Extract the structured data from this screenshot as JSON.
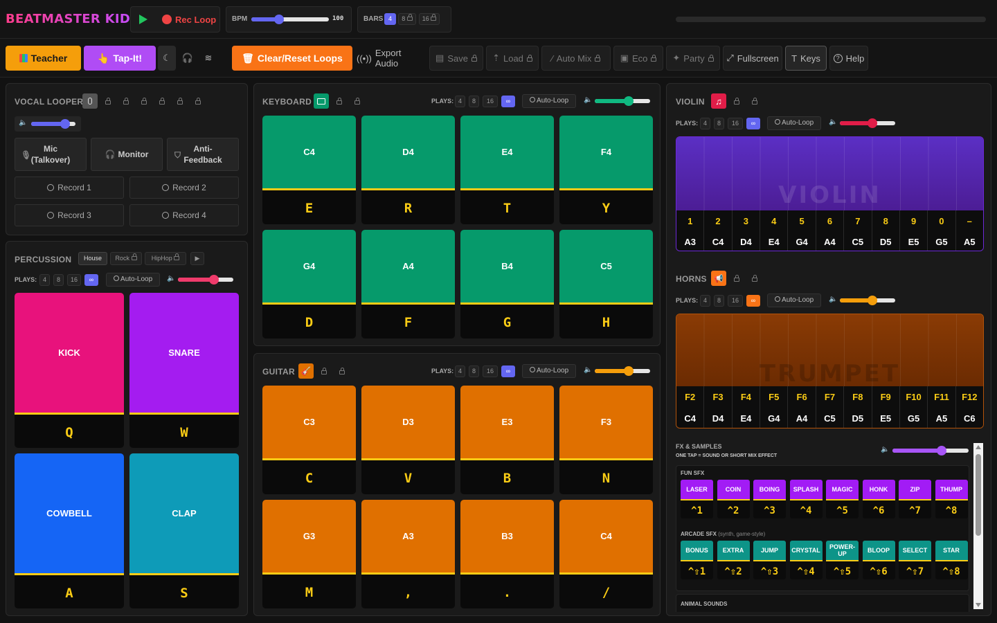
{
  "app": {
    "title": "BEATMASTER KIDS"
  },
  "transport": {
    "rec_loop": "Rec Loop",
    "bpm_label": "BPM",
    "bpm_value": "100",
    "bars_label": "BARS",
    "bars": [
      "4",
      "8",
      "16"
    ],
    "bars_selected": "4"
  },
  "toolbar": {
    "teacher": "Teacher",
    "tap_it": "Tap-It!",
    "clear_reset": "Clear/Reset Loops",
    "export_audio": "Export Audio",
    "save": "Save",
    "load": "Load",
    "auto_mix": "Auto Mix",
    "eco": "Eco",
    "party": "Party",
    "fullscreen": "Fullscreen",
    "keys": "Keys",
    "help": "Help"
  },
  "vocal": {
    "title": "VOCAL LOOPER",
    "mic": "Mic\n(Talkover)",
    "monitor": "Monitor",
    "anti_feedback": "Anti-\nFeedback",
    "records": [
      "Record 1",
      "Record 2",
      "Record 3",
      "Record 4"
    ],
    "volume": 0.75
  },
  "percussion": {
    "title": "PERCUSSION",
    "styles": [
      "House",
      "Rock",
      "HipHop"
    ],
    "plays_label": "PLAYS:",
    "plays": [
      "4",
      "8",
      "16",
      "∞"
    ],
    "auto_loop": "Auto-Loop",
    "volume": 0.65,
    "pads": [
      {
        "name": "KICK",
        "key": "Q",
        "color": "#e8127c"
      },
      {
        "name": "SNARE",
        "key": "W",
        "color": "#a41cf0"
      },
      {
        "name": "COWBELL",
        "key": "A",
        "color": "#1565f5"
      },
      {
        "name": "CLAP",
        "key": "S",
        "color": "#0e9bb8"
      }
    ]
  },
  "keyboard": {
    "title": "KEYBOARD",
    "plays_label": "PLAYS:",
    "plays": [
      "4",
      "8",
      "16",
      "∞"
    ],
    "auto_loop": "Auto-Loop",
    "volume": 0.7,
    "pads": [
      {
        "note": "C4",
        "key": "E"
      },
      {
        "note": "D4",
        "key": "R"
      },
      {
        "note": "E4",
        "key": "T"
      },
      {
        "note": "F4",
        "key": "Y"
      },
      {
        "note": "G4",
        "key": "D"
      },
      {
        "note": "A4",
        "key": "F"
      },
      {
        "note": "B4",
        "key": "G"
      },
      {
        "note": "C5",
        "key": "H"
      }
    ],
    "color": "#069a6b"
  },
  "guitar": {
    "title": "GUITAR",
    "plays_label": "PLAYS:",
    "plays": [
      "4",
      "8",
      "16",
      "∞"
    ],
    "auto_loop": "Auto-Loop",
    "volume": 0.7,
    "pads": [
      {
        "note": "C3",
        "key": "C"
      },
      {
        "note": "D3",
        "key": "V"
      },
      {
        "note": "E3",
        "key": "B"
      },
      {
        "note": "F3",
        "key": "N"
      },
      {
        "note": "G3",
        "key": "M"
      },
      {
        "note": "A3",
        "key": ","
      },
      {
        "note": "B3",
        "key": "."
      },
      {
        "note": "C4",
        "key": "/"
      }
    ],
    "color": "#e07000"
  },
  "violin": {
    "title": "VIOLIN",
    "plays_label": "PLAYS:",
    "plays": [
      "4",
      "8",
      "16",
      "∞"
    ],
    "auto_loop": "Auto-Loop",
    "volume": 0.6,
    "watermark": "VIOLIN",
    "keys": [
      "1",
      "2",
      "3",
      "4",
      "5",
      "6",
      "7",
      "8",
      "9",
      "0",
      "–"
    ],
    "notes": [
      "A3",
      "C4",
      "D4",
      "E4",
      "G4",
      "A4",
      "C5",
      "D5",
      "E5",
      "G5",
      "A5"
    ]
  },
  "horns": {
    "title": "HORNS",
    "plays_label": "PLAYS:",
    "plays": [
      "4",
      "8",
      "16",
      "∞"
    ],
    "auto_loop": "Auto-Loop",
    "volume": 0.6,
    "watermark": "TRUMPET",
    "keys": [
      "F2",
      "F3",
      "F4",
      "F5",
      "F6",
      "F7",
      "F8",
      "F9",
      "F10",
      "F11",
      "F12"
    ],
    "notes": [
      "C4",
      "D4",
      "E4",
      "G4",
      "A4",
      "C5",
      "D5",
      "E5",
      "G5",
      "A5",
      "C6"
    ]
  },
  "fx": {
    "title": "FX & SAMPLES",
    "subtitle": "ONE TAP = SOUND OR SHORT MIX EFFECT",
    "volume": 0.6,
    "fun_title": "FUN SFX",
    "fun": [
      {
        "label": "LASER",
        "key": "^1"
      },
      {
        "label": "COIN",
        "key": "^2"
      },
      {
        "label": "BOING",
        "key": "^3"
      },
      {
        "label": "SPLASH",
        "key": "^4"
      },
      {
        "label": "MAGIC",
        "key": "^5"
      },
      {
        "label": "HONK",
        "key": "^6"
      },
      {
        "label": "ZIP",
        "key": "^7"
      },
      {
        "label": "THUMP",
        "key": "^8"
      }
    ],
    "arcade_title": "ARCADE SFX",
    "arcade_sub": "(synth, game-style)",
    "arcade": [
      {
        "label": "BONUS",
        "key": "^⇧1"
      },
      {
        "label": "EXTRA",
        "key": "^⇧2"
      },
      {
        "label": "JUMP",
        "key": "^⇧3"
      },
      {
        "label": "CRYSTAL",
        "key": "^⇧4"
      },
      {
        "label": "POWER-UP",
        "key": "^⇧5"
      },
      {
        "label": "BLOOP",
        "key": "^⇧6"
      },
      {
        "label": "SELECT",
        "key": "^⇧7"
      },
      {
        "label": "STAR",
        "key": "^⇧8"
      }
    ],
    "animal_title": "ANIMAL SOUNDS"
  }
}
